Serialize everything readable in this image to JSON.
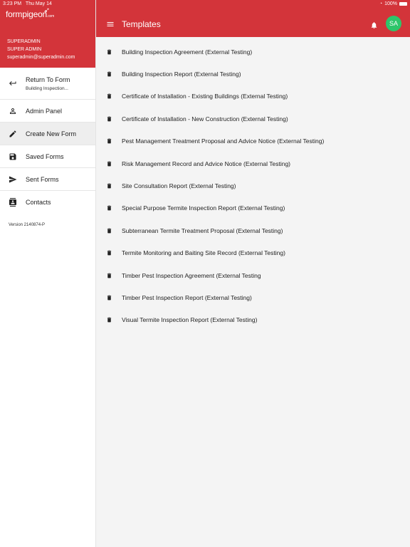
{
  "status_bar": {
    "time": "3:23 PM",
    "date": "Thu May 14",
    "battery": "100%"
  },
  "sidebar": {
    "logo_text": "formpigeon",
    "logo_suffix": ".com",
    "user_name": "SUPERADMIN",
    "user_role": "SUPER ADMIN",
    "user_email": "superadmin@superadmin.com",
    "items": [
      {
        "label": "Return To Form",
        "sub": "Building Inspection...",
        "icon": "return-arrow-icon"
      },
      {
        "label": "Admin Panel",
        "icon": "person-icon"
      },
      {
        "label": "Create New Form",
        "icon": "pencil-icon"
      },
      {
        "label": "Saved Forms",
        "icon": "save-icon"
      },
      {
        "label": "Sent Forms",
        "icon": "send-icon"
      },
      {
        "label": "Contacts",
        "icon": "contacts-icon"
      }
    ],
    "version": "Version 2140874-P"
  },
  "header": {
    "title": "Templates",
    "avatar_initials": "SA",
    "avatar_color": "#2ec56a",
    "brand_color": "#d3343a"
  },
  "templates": [
    "Building Inspection Agreement (External Testing)",
    "Building Inspection Report (External Testing)",
    "Certificate of Installation - Existing Buildings (External Testing)",
    "Certificate of Installation - New Construction (External Testing)",
    "Pest Management Treatment Proposal and Advice Notice (External Testing)",
    "Risk Management Record and Advice Notice (External Testing)",
    "Site Consultation Report (External Testing)",
    "Special Purpose Termite Inspection Report (External Testing)",
    "Subterranean Termite Treatment Proposal (External Testing)",
    "Termite Monitoring and Baiting Site Record (External Testing)",
    "Timber Pest Inspection Agreement (External Testing",
    "Timber Pest Inspection Report (External Testing)",
    "Visual Termite Inspection Report (External Testing)"
  ]
}
